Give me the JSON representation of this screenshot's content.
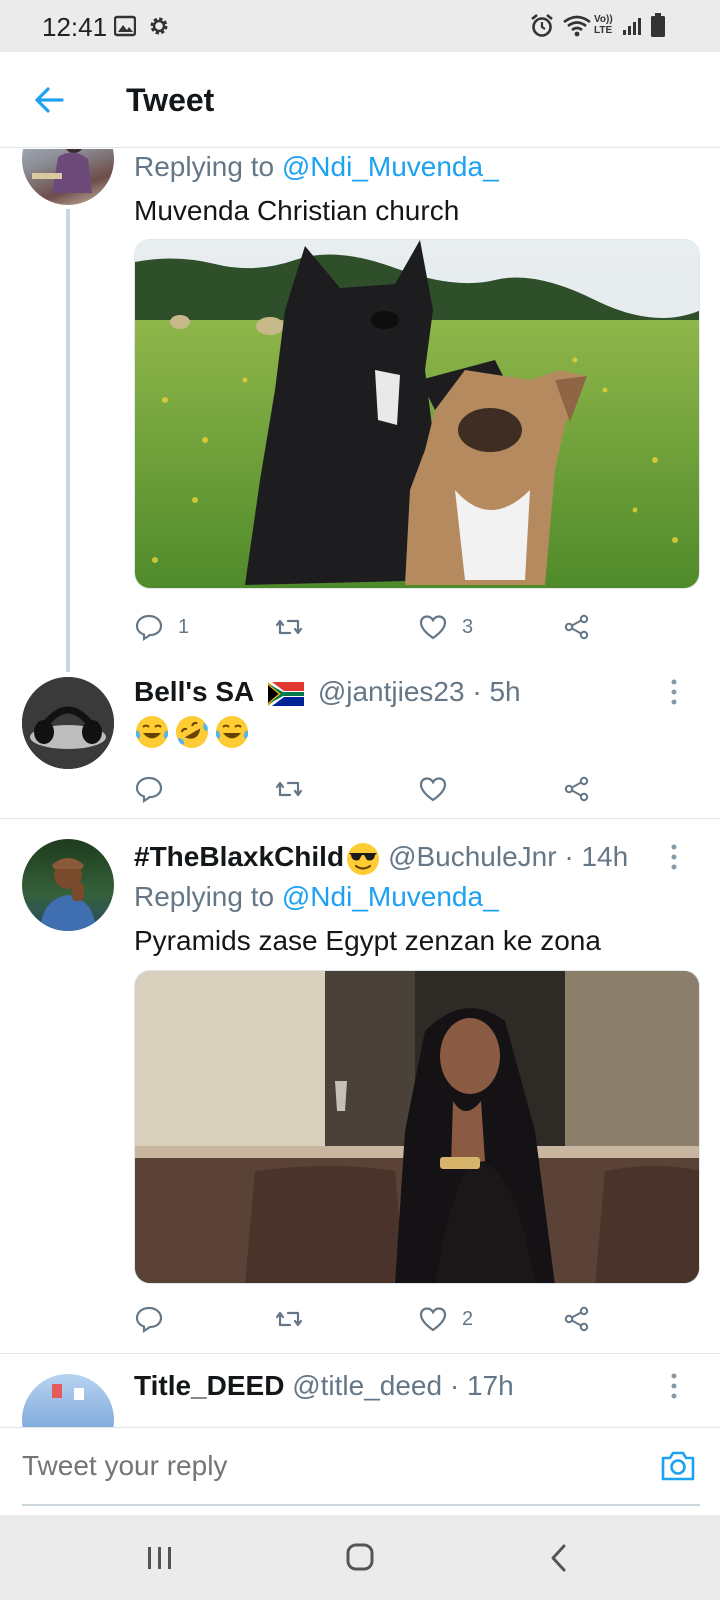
{
  "status_bar": {
    "time": "12:41",
    "network": "Vo)) LTE"
  },
  "header": {
    "title": "Tweet"
  },
  "tweets": [
    {
      "reply_prefix": "Replying to ",
      "reply_mention": "@Ndi_Muvenda_",
      "text": "Muvenda Christian church",
      "media": "photo of two french bulldogs in a field",
      "replies": "1",
      "retweets": "",
      "likes": "3"
    },
    {
      "name": "Bell's SA",
      "handle": "@jantjies23 · 5h",
      "emojis": [
        "face-with-tears-of-joy",
        "rolling-on-floor-laughing",
        "face-with-tears-of-joy"
      ],
      "replies": "",
      "retweets": "",
      "likes": ""
    },
    {
      "name": "#TheBlaxkChild",
      "handle": "@BuchuleJnr · 14h",
      "reply_prefix": "Replying to ",
      "reply_mention": "@Ndi_Muvenda_",
      "text": "Pyramids zase Egypt zenzan ke zona",
      "media": "photo of woman resting chin on hand",
      "replies": "",
      "retweets": "",
      "likes": "2"
    },
    {
      "name": "Title_DEED",
      "handle": "@title_deed · 17h"
    }
  ],
  "reply_bar": {
    "placeholder": "Tweet your reply"
  },
  "colors": {
    "accent": "#1da1f2",
    "text": "#14171a",
    "secondary": "#657786",
    "divider": "#e1e8ed"
  }
}
